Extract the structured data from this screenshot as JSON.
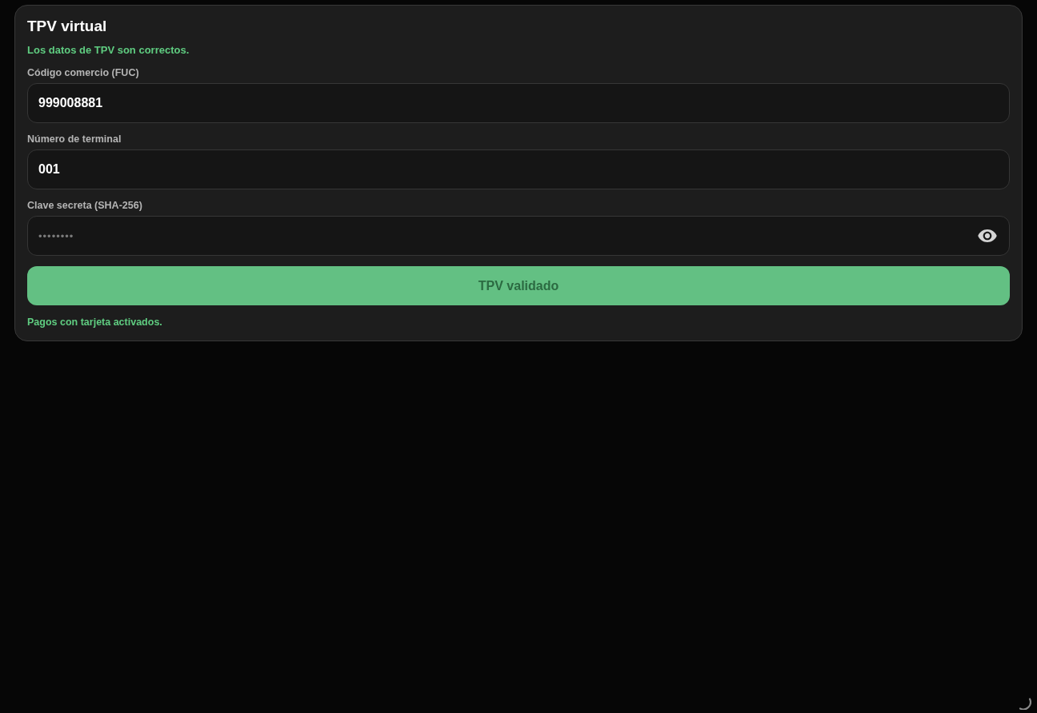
{
  "card": {
    "title": "TPV virtual",
    "status_message": "Los datos de TPV son correctos.",
    "fields": [
      {
        "kind": "text",
        "label": "Código comercio (FUC)",
        "value": "999008881"
      },
      {
        "kind": "text",
        "label": "Número de terminal",
        "value": "001"
      },
      {
        "kind": "password",
        "label": "Clave secreta (SHA-256)",
        "placeholder": "••••••••"
      }
    ],
    "submit_button": {
      "label": "TPV validado",
      "disabled": true
    },
    "footer_message": "Pagos con tarjeta activados."
  }
}
